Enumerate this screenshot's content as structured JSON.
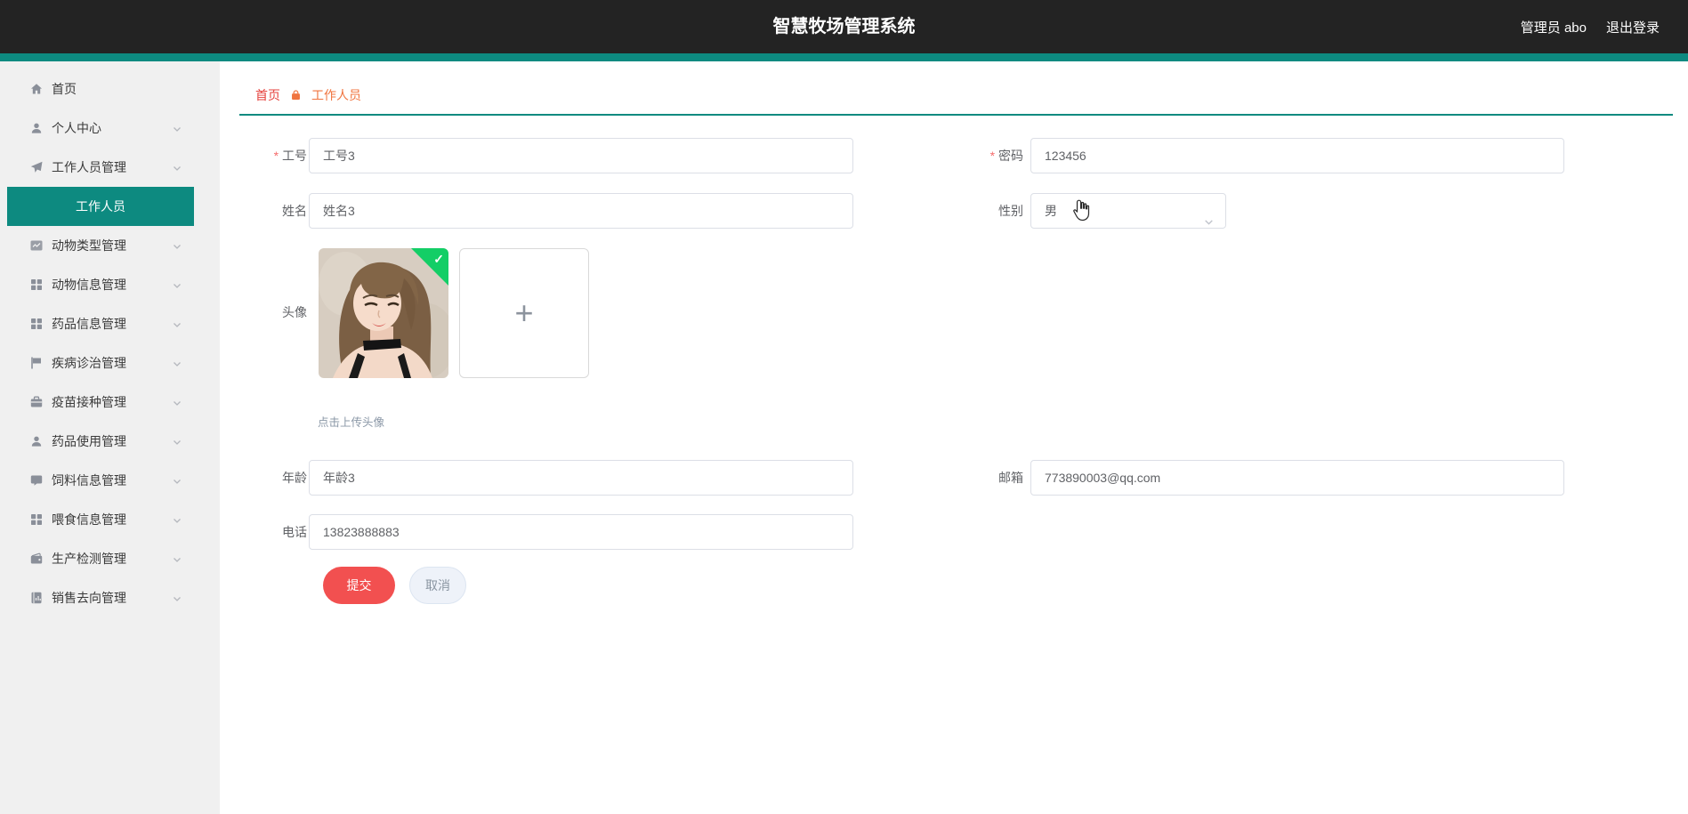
{
  "header": {
    "title": "智慧牧场管理系统",
    "user": "管理员 abo",
    "logout": "退出登录"
  },
  "breadcrumb": {
    "home": "首页",
    "current": "工作人员"
  },
  "sidebar": {
    "items": [
      {
        "label": "首页",
        "icon": "home-icon"
      },
      {
        "label": "个人中心",
        "icon": "user-icon"
      },
      {
        "label": "工作人员管理",
        "icon": "send-icon",
        "children": [
          {
            "label": "工作人员",
            "active": true
          }
        ]
      },
      {
        "label": "动物类型管理",
        "icon": "trend-chart-icon"
      },
      {
        "label": "动物信息管理",
        "icon": "grid-icon"
      },
      {
        "label": "药品信息管理",
        "icon": "grid-icon"
      },
      {
        "label": "疾病诊治管理",
        "icon": "flag-icon"
      },
      {
        "label": "疫苗接种管理",
        "icon": "suitcase-icon"
      },
      {
        "label": "药品使用管理",
        "icon": "user-solid-icon"
      },
      {
        "label": "饲料信息管理",
        "icon": "message-icon"
      },
      {
        "label": "喂食信息管理",
        "icon": "grid-icon"
      },
      {
        "label": "生产检测管理",
        "icon": "finance-icon"
      },
      {
        "label": "销售去向管理",
        "icon": "notebook-icon"
      }
    ]
  },
  "form": {
    "employee_id": {
      "label": "工号",
      "value": "工号3",
      "required": true
    },
    "password": {
      "label": "密码",
      "value": "123456",
      "required": true
    },
    "name": {
      "label": "姓名",
      "value": "姓名3"
    },
    "gender": {
      "label": "性别",
      "value": "男"
    },
    "avatar": {
      "label": "头像",
      "hint": "点击上传头像",
      "status": "uploaded"
    },
    "age": {
      "label": "年龄",
      "value": "年龄3"
    },
    "email": {
      "label": "邮箱",
      "value": "773890003@qq.com"
    },
    "phone": {
      "label": "电话",
      "value": "13823888883"
    },
    "submit_label": "提交",
    "cancel_label": "取消"
  },
  "colors": {
    "accent_teal": "#0d8a80",
    "header_bg": "#232323",
    "breadcrumb_home": "#e6413c",
    "breadcrumb_current": "#f0743f",
    "submit_red": "#f25050",
    "upload_success_green": "#13ce66"
  }
}
